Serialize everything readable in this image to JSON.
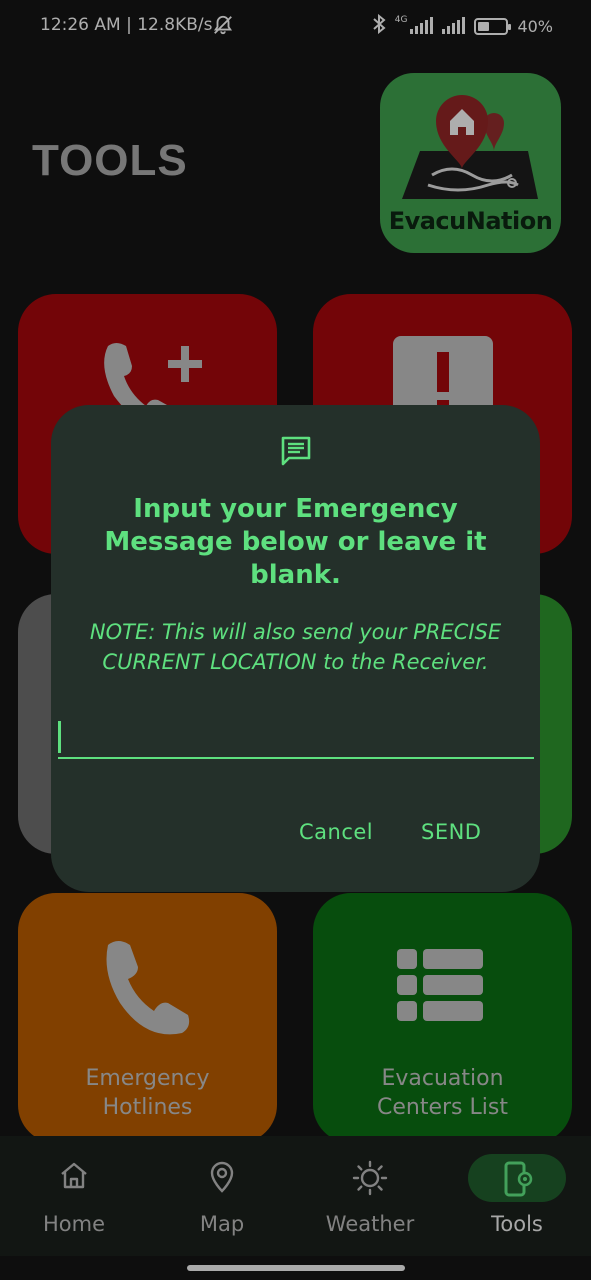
{
  "status_bar": {
    "time_speed": "12:26 AM | 12.8KB/s",
    "network_label": "4G",
    "battery_text": "40%",
    "battery_level": 0.4
  },
  "header": {
    "title": "TOOLS",
    "logo_text": "EvacuNation"
  },
  "tiles": [
    {
      "id": "add-contact",
      "label": "",
      "color": "#a0070c"
    },
    {
      "id": "alert",
      "label": "",
      "color": "#a0070c"
    },
    {
      "id": "grey-tile",
      "label": "",
      "color": "#6b6b6b"
    },
    {
      "id": "green-tile",
      "label": "",
      "color": "#2b8f2b"
    },
    {
      "id": "hotlines",
      "label": "Emergency\nHotlines",
      "color": "#b35900"
    },
    {
      "id": "centers",
      "label": "Evacuation\nCenters List",
      "color": "#0b6b12"
    }
  ],
  "nav": {
    "items": [
      {
        "label": "Home",
        "icon": "home-icon"
      },
      {
        "label": "Map",
        "icon": "map-pin-icon"
      },
      {
        "label": "Weather",
        "icon": "sun-icon"
      },
      {
        "label": "Tools",
        "icon": "phone-settings-icon"
      }
    ],
    "active_index": 3
  },
  "dialog": {
    "icon": "message-icon",
    "title": "Input your Emergency Message below or leave it blank.",
    "note": "NOTE: This will also send your PRECISE CURRENT LOCATION to the Receiver.",
    "input_value": "",
    "input_placeholder": "",
    "cancel_label": "Cancel",
    "send_label": "SEND"
  },
  "colors": {
    "accent": "#5ee07f",
    "dialog_bg": "#24302a",
    "background": "#141414"
  }
}
